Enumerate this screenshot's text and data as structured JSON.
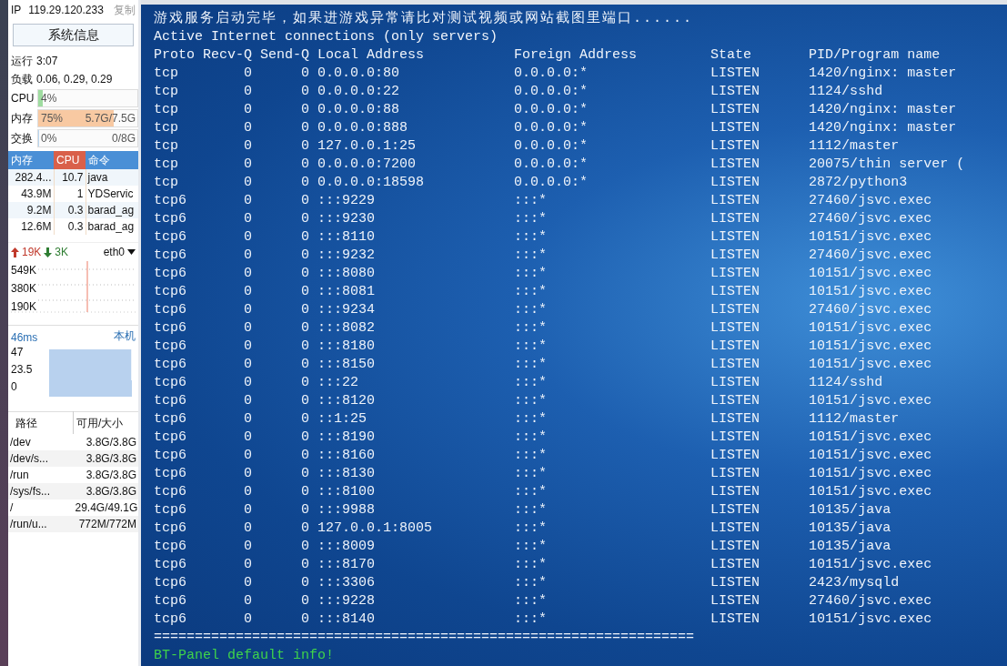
{
  "sidebar": {
    "ip_label": "IP",
    "ip": "119.29.120.233",
    "copy": "复制",
    "sysinfo_button": "系统信息",
    "stats": [
      {
        "label": "运行",
        "value": "3:07"
      },
      {
        "label": "负载",
        "value": "0.06, 0.29, 0.29"
      }
    ],
    "meters": [
      {
        "kind": "cpu",
        "label": "CPU",
        "percent": "4%",
        "level": 0.04
      },
      {
        "kind": "memory",
        "label": "内存",
        "percent": "75%",
        "detail": "5.7G/7.5G",
        "level": 0.75
      },
      {
        "kind": "swap",
        "label": "交换",
        "percent": "0%",
        "detail": "0/8G",
        "level": 0
      }
    ],
    "processes": {
      "columns": [
        {
          "label": "内存",
          "kind": "memory"
        },
        {
          "label": "CPU",
          "kind": "cpu"
        },
        {
          "label": "命令",
          "kind": "command"
        }
      ],
      "rows": [
        [
          "282.4...",
          "10.7",
          "java"
        ],
        [
          "43.9M",
          "1",
          "YDServic"
        ],
        [
          "9.2M",
          "0.3",
          "barad_ag"
        ],
        [
          "12.6M",
          "0.3",
          "barad_ag"
        ]
      ]
    },
    "network": {
      "up": "19K",
      "down": "3K",
      "interface": "eth0",
      "axis": [
        "549K",
        "380K",
        "190K"
      ]
    },
    "latency": {
      "value": "46ms",
      "target": "本机",
      "axis": [
        "47",
        "23.5",
        "0"
      ]
    },
    "disks": {
      "columns": [
        "路径",
        "可用/大小"
      ],
      "rows": [
        [
          "/dev",
          "3.8G/3.8G"
        ],
        [
          "/dev/s...",
          "3.8G/3.8G"
        ],
        [
          "/run",
          "3.8G/3.8G"
        ],
        [
          "/sys/fs...",
          "3.8G/3.8G"
        ],
        [
          "/",
          "29.4G/49.1G"
        ],
        [
          "/run/u...",
          "772M/772M"
        ]
      ]
    }
  },
  "terminal": {
    "notice": "游戏服务启动完毕，如果进游戏异常请比对测试视频或网站截图里端口......",
    "heading": "Active Internet connections (only servers)",
    "columns": [
      "Proto",
      "Recv-Q",
      "Send-Q",
      "Local Address",
      "Foreign Address",
      "State",
      "PID/Program name"
    ],
    "connections": [
      [
        "tcp",
        "0",
        "0",
        "0.0.0.0:80",
        "0.0.0.0:*",
        "LISTEN",
        "1420/nginx: master"
      ],
      [
        "tcp",
        "0",
        "0",
        "0.0.0.0:22",
        "0.0.0.0:*",
        "LISTEN",
        "1124/sshd"
      ],
      [
        "tcp",
        "0",
        "0",
        "0.0.0.0:88",
        "0.0.0.0:*",
        "LISTEN",
        "1420/nginx: master"
      ],
      [
        "tcp",
        "0",
        "0",
        "0.0.0.0:888",
        "0.0.0.0:*",
        "LISTEN",
        "1420/nginx: master"
      ],
      [
        "tcp",
        "0",
        "0",
        "127.0.0.1:25",
        "0.0.0.0:*",
        "LISTEN",
        "1112/master"
      ],
      [
        "tcp",
        "0",
        "0",
        "0.0.0.0:7200",
        "0.0.0.0:*",
        "LISTEN",
        "20075/thin server ("
      ],
      [
        "tcp",
        "0",
        "0",
        "0.0.0.0:18598",
        "0.0.0.0:*",
        "LISTEN",
        "2872/python3"
      ],
      [
        "tcp6",
        "0",
        "0",
        ":::9229",
        ":::*",
        "LISTEN",
        "27460/jsvc.exec"
      ],
      [
        "tcp6",
        "0",
        "0",
        ":::9230",
        ":::*",
        "LISTEN",
        "27460/jsvc.exec"
      ],
      [
        "tcp6",
        "0",
        "0",
        ":::8110",
        ":::*",
        "LISTEN",
        "10151/jsvc.exec"
      ],
      [
        "tcp6",
        "0",
        "0",
        ":::9232",
        ":::*",
        "LISTEN",
        "27460/jsvc.exec"
      ],
      [
        "tcp6",
        "0",
        "0",
        ":::8080",
        ":::*",
        "LISTEN",
        "10151/jsvc.exec"
      ],
      [
        "tcp6",
        "0",
        "0",
        ":::8081",
        ":::*",
        "LISTEN",
        "10151/jsvc.exec"
      ],
      [
        "tcp6",
        "0",
        "0",
        ":::9234",
        ":::*",
        "LISTEN",
        "27460/jsvc.exec"
      ],
      [
        "tcp6",
        "0",
        "0",
        ":::8082",
        ":::*",
        "LISTEN",
        "10151/jsvc.exec"
      ],
      [
        "tcp6",
        "0",
        "0",
        ":::8180",
        ":::*",
        "LISTEN",
        "10151/jsvc.exec"
      ],
      [
        "tcp6",
        "0",
        "0",
        ":::8150",
        ":::*",
        "LISTEN",
        "10151/jsvc.exec"
      ],
      [
        "tcp6",
        "0",
        "0",
        ":::22",
        ":::*",
        "LISTEN",
        "1124/sshd"
      ],
      [
        "tcp6",
        "0",
        "0",
        ":::8120",
        ":::*",
        "LISTEN",
        "10151/jsvc.exec"
      ],
      [
        "tcp6",
        "0",
        "0",
        "::1:25",
        ":::*",
        "LISTEN",
        "1112/master"
      ],
      [
        "tcp6",
        "0",
        "0",
        ":::8190",
        ":::*",
        "LISTEN",
        "10151/jsvc.exec"
      ],
      [
        "tcp6",
        "0",
        "0",
        ":::8160",
        ":::*",
        "LISTEN",
        "10151/jsvc.exec"
      ],
      [
        "tcp6",
        "0",
        "0",
        ":::8130",
        ":::*",
        "LISTEN",
        "10151/jsvc.exec"
      ],
      [
        "tcp6",
        "0",
        "0",
        ":::8100",
        ":::*",
        "LISTEN",
        "10151/jsvc.exec"
      ],
      [
        "tcp6",
        "0",
        "0",
        ":::9988",
        ":::*",
        "LISTEN",
        "10135/java"
      ],
      [
        "tcp6",
        "0",
        "0",
        "127.0.0.1:8005",
        ":::*",
        "LISTEN",
        "10135/java"
      ],
      [
        "tcp6",
        "0",
        "0",
        ":::8009",
        ":::*",
        "LISTEN",
        "10135/java"
      ],
      [
        "tcp6",
        "0",
        "0",
        ":::8170",
        ":::*",
        "LISTEN",
        "10151/jsvc.exec"
      ],
      [
        "tcp6",
        "0",
        "0",
        ":::3306",
        ":::*",
        "LISTEN",
        "2423/mysqld"
      ],
      [
        "tcp6",
        "0",
        "0",
        ":::9228",
        ":::*",
        "LISTEN",
        "27460/jsvc.exec"
      ],
      [
        "tcp6",
        "0",
        "0",
        ":::8140",
        ":::*",
        "LISTEN",
        "10151/jsvc.exec"
      ]
    ],
    "separator": "==================================================================",
    "footer": "BT-Panel default info!"
  }
}
